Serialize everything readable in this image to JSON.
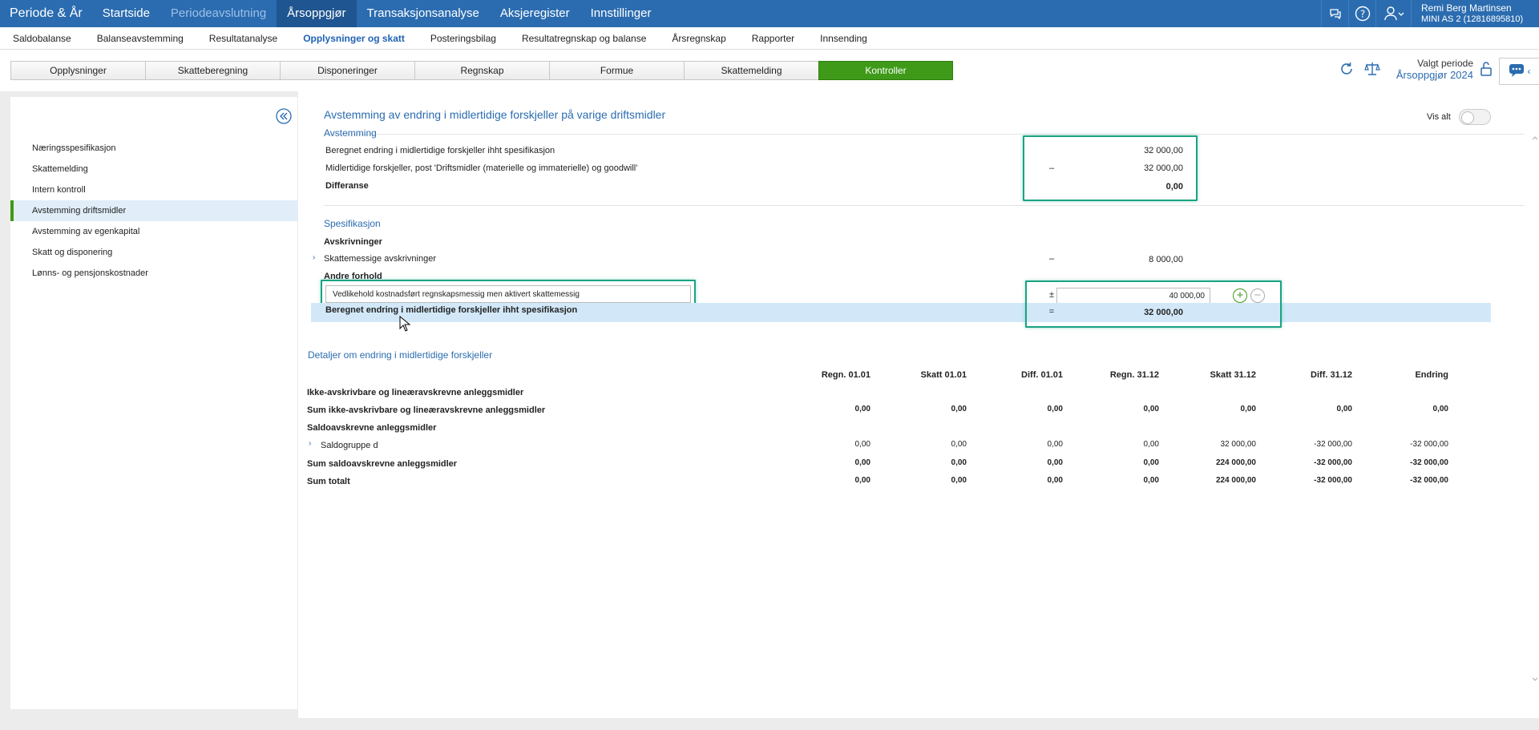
{
  "topbar": {
    "brand": "Periode & År",
    "nav": [
      "Startside",
      "Periodeavslutning",
      "Årsoppgjør",
      "Transaksjonsanalyse",
      "Aksjeregister",
      "Innstillinger"
    ],
    "user_name": "Remi Berg Martinsen",
    "user_org": "MINI AS 2 (12816895810)"
  },
  "subnav": [
    "Saldobalanse",
    "Balanseavstemming",
    "Resultatanalyse",
    "Opplysninger og skatt",
    "Posteringsbilag",
    "Resultatregnskap og balanse",
    "Årsregnskap",
    "Rapporter",
    "Innsending"
  ],
  "tabs": [
    "Opplysninger",
    "Skatteberegning",
    "Disponeringer",
    "Regnskap",
    "Formue",
    "Skattemelding",
    "Kontroller"
  ],
  "periode": {
    "label": "Valgt periode",
    "value": "Årsoppgjør 2024"
  },
  "sidebar": [
    "Næringsspesifikasjon",
    "Skattemelding",
    "Intern kontroll",
    "Avstemming driftsmidler",
    "Avstemming av egenkapital",
    "Skatt og disponering",
    "Lønns- og pensjonskostnader"
  ],
  "main": {
    "title": "Avstemming av endring i midlertidige forskjeller på varige driftsmidler",
    "vis_alt": "Vis alt",
    "avstemming": {
      "heading": "Avstemming",
      "rows": [
        {
          "label": "Beregnet endring i midlertidige forskjeller ihht spesifikasjon",
          "op": "",
          "value": "32 000,00"
        },
        {
          "label": "Midlertidige forskjeller, post 'Driftsmidler (materielle og immaterielle) og goodwill'",
          "op": "–",
          "value": "32 000,00"
        },
        {
          "label": "Differanse",
          "op": "",
          "value": "0,00"
        }
      ]
    },
    "spesifikasjon": {
      "heading": "Spesifikasjon",
      "avskrivninger": "Avskrivninger",
      "skattemessige_label": "Skattemessige avskrivninger",
      "skattemessige_op": "–",
      "skattemessige_value": "8 000,00",
      "andre_forhold": "Andre forhold",
      "input_text": "Vedlikehold kostnadsført regnskapsmessig men aktivert skattemessig",
      "input_op": "±",
      "input_value": "40 000,00",
      "total_label": "Beregnet endring i midlertidige forskjeller ihht spesifikasjon",
      "total_op": "=",
      "total_value": "32 000,00"
    },
    "detaljer": {
      "heading": "Detaljer om endring i midlertidige forskjeller",
      "columns": [
        "Regn. 01.01",
        "Skatt 01.01",
        "Diff. 01.01",
        "Regn. 31.12",
        "Skatt 31.12",
        "Diff. 31.12",
        "Endring"
      ],
      "rows": [
        {
          "label": "Ikke-avskrivbare og lineæravskrevne anleggsmidler",
          "bold": true,
          "values": []
        },
        {
          "label": "Sum ikke-avskrivbare og lineæravskrevne anleggsmidler",
          "bold": true,
          "values": [
            "0,00",
            "0,00",
            "0,00",
            "0,00",
            "0,00",
            "0,00",
            "0,00"
          ]
        },
        {
          "label": "Saldoavskrevne anleggsmidler",
          "bold": true,
          "values": []
        },
        {
          "label": "Saldogruppe d",
          "bold": false,
          "values": [
            "0,00",
            "0,00",
            "0,00",
            "0,00",
            "32 000,00",
            "-32 000,00",
            "-32 000,00"
          ]
        },
        {
          "label": "Sum saldoavskrevne anleggsmidler",
          "bold": true,
          "values": [
            "0,00",
            "0,00",
            "0,00",
            "0,00",
            "224 000,00",
            "-32 000,00",
            "-32 000,00"
          ]
        },
        {
          "label": "Sum totalt",
          "bold": true,
          "values": [
            "0,00",
            "0,00",
            "0,00",
            "0,00",
            "224 000,00",
            "-32 000,00",
            "-32 000,00"
          ]
        }
      ]
    }
  }
}
